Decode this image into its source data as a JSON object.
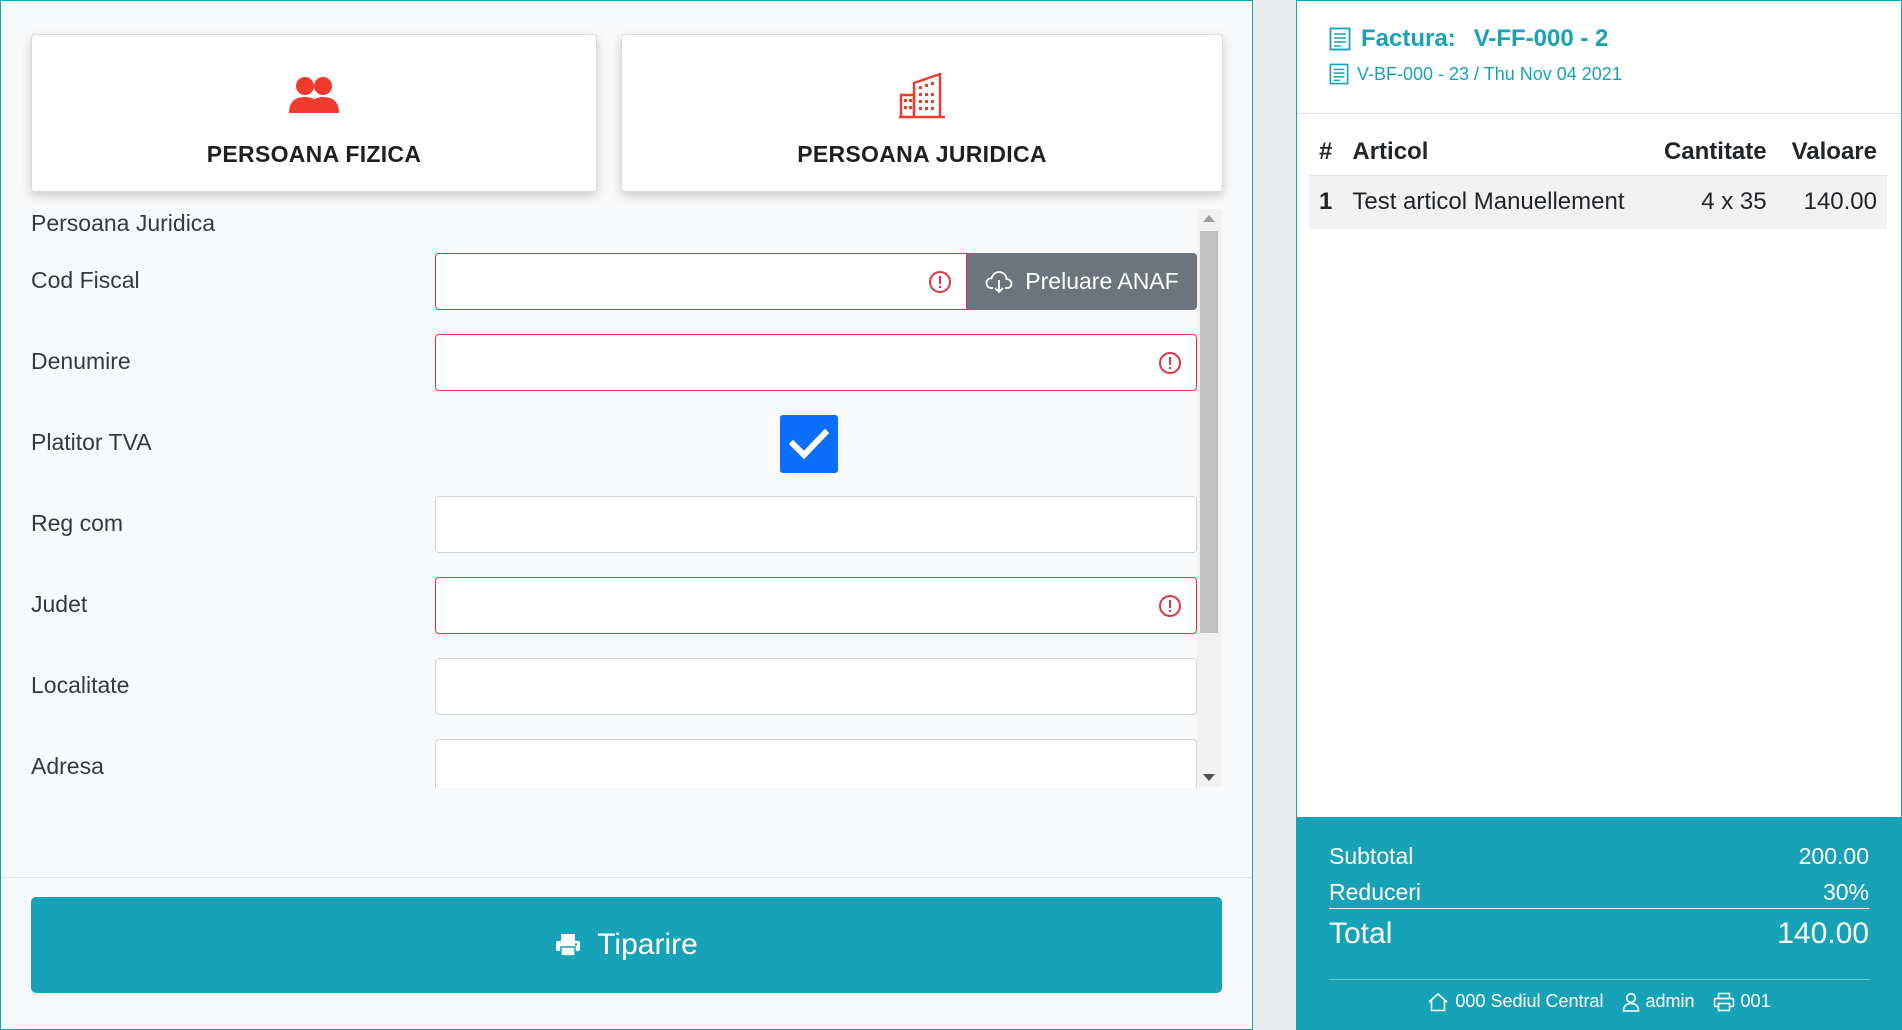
{
  "customer_types": {
    "fizica_label": "PERSOANA FIZICA",
    "juridica_label": "PERSOANA JURIDICA"
  },
  "form": {
    "section_title": "Persoana Juridica",
    "cod_fiscal_label": "Cod Fiscal",
    "cod_fiscal_value": "",
    "anaf_button": "Preluare ANAF",
    "denumire_label": "Denumire",
    "denumire_value": "",
    "platitor_tva_label": "Platitor TVA",
    "platitor_tva_checked": true,
    "reg_com_label": "Reg com",
    "reg_com_value": "",
    "judet_label": "Judet",
    "judet_value": "",
    "localitate_label": "Localitate",
    "localitate_value": "",
    "adresa_label": "Adresa",
    "adresa_value": ""
  },
  "print_button": "Tiparire",
  "invoice": {
    "title_label": "Factura:",
    "title_value": "V-FF-000 - 2",
    "subtitle": "V-BF-000 - 23 / Thu Nov 04 2021",
    "columns": [
      "#",
      "Articol",
      "Cantitate",
      "Valoare"
    ],
    "items": [
      {
        "num": "1",
        "articol": "Test articol Manuellement",
        "cantitate": "4 x 35",
        "valoare": "140.00"
      }
    ]
  },
  "totals": {
    "subtotal_label": "Subtotal",
    "subtotal_value": "200.00",
    "reduceri_label": "Reduceri",
    "reduceri_value": "30%",
    "total_label": "Total",
    "total_value": "140.00"
  },
  "footer": {
    "location": "000 Sediul Central",
    "user": "admin",
    "printer": "001"
  },
  "colors": {
    "accent": "#17a2b8",
    "error": "#dc3545",
    "checkbox": "#0d6efd",
    "secondary_button": "#6c757d",
    "icon_red": "#f03a2e"
  }
}
